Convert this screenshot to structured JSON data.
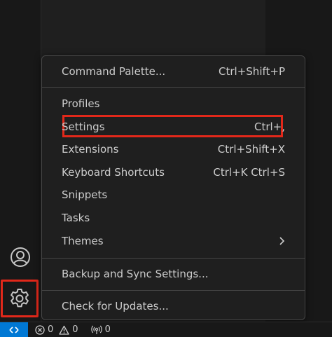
{
  "menu": {
    "items": [
      {
        "label": "Command Palette...",
        "shortcut": "Ctrl+Shift+P"
      },
      {
        "label": "Profiles",
        "shortcut": ""
      },
      {
        "label": "Settings",
        "shortcut": "Ctrl+,"
      },
      {
        "label": "Extensions",
        "shortcut": "Ctrl+Shift+X"
      },
      {
        "label": "Keyboard Shortcuts",
        "shortcut": "Ctrl+K Ctrl+S"
      },
      {
        "label": "Snippets",
        "shortcut": ""
      },
      {
        "label": "Tasks",
        "shortcut": ""
      },
      {
        "label": "Themes",
        "shortcut": ""
      },
      {
        "label": "Backup and Sync Settings...",
        "shortcut": ""
      },
      {
        "label": "Check for Updates...",
        "shortcut": ""
      }
    ]
  },
  "activity_bar": {
    "account_icon": "account-icon",
    "manage_icon": "gear-icon"
  },
  "status_bar": {
    "errors": "0",
    "warnings": "0",
    "ports": "0"
  },
  "colors": {
    "highlight": "#e2281a",
    "remote_accent": "#0078d4",
    "menu_bg": "#1f1f1f",
    "text": "#cccccc"
  }
}
